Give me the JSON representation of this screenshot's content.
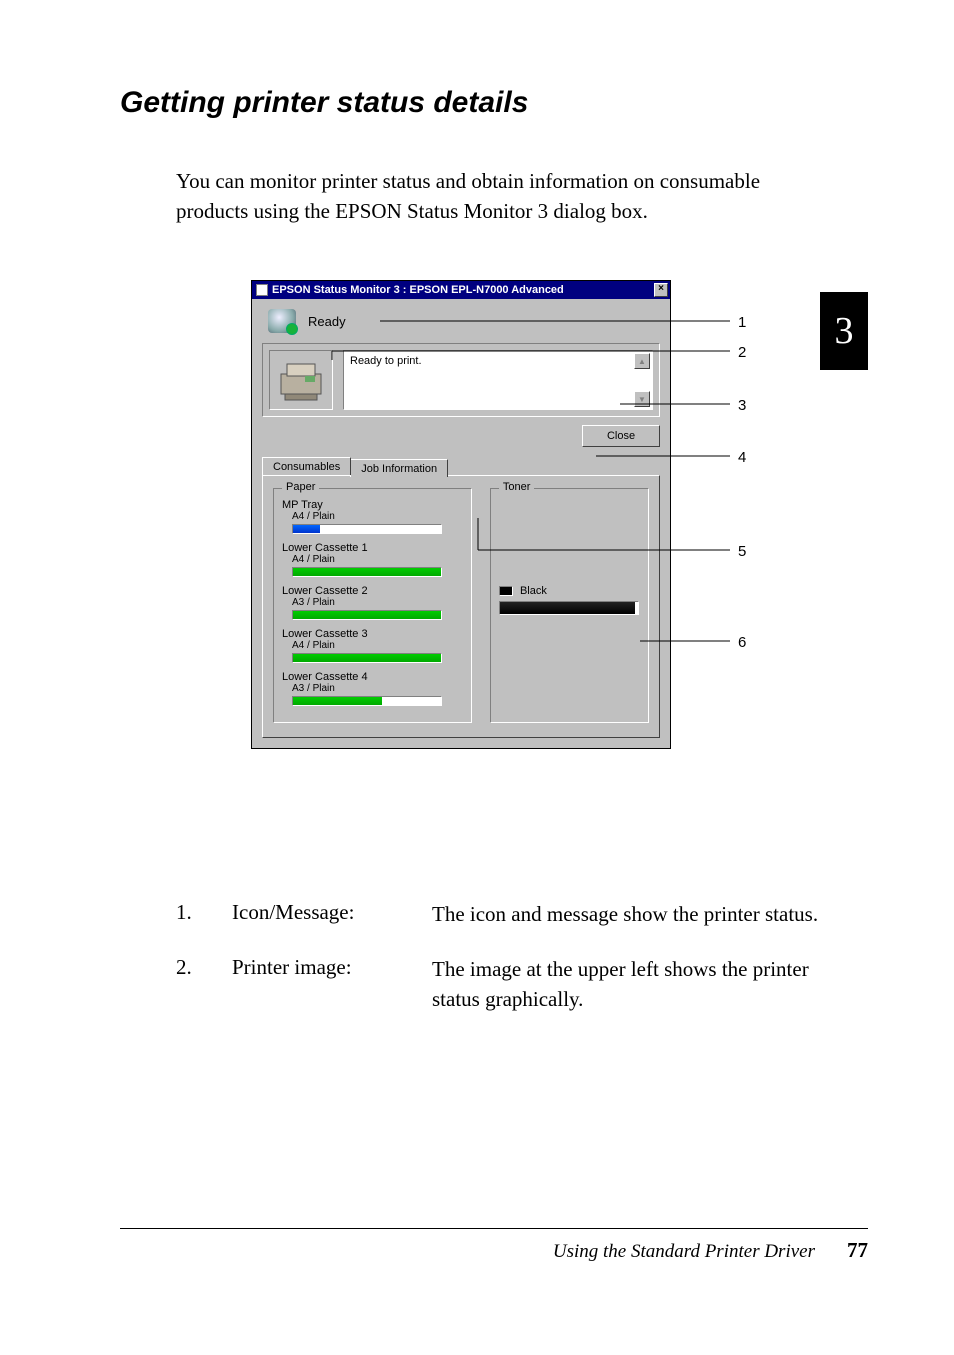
{
  "heading": "Getting printer status details",
  "intro": "You can monitor printer status and obtain information on consumable products using the EPSON Status Monitor 3 dialog box.",
  "chapter_tab": "3",
  "dialog": {
    "title": "EPSON Status Monitor 3 : EPSON EPL-N7000 Advanced",
    "status_text": "Ready",
    "message": "Ready to print.",
    "close_button": "Close",
    "tabs": {
      "consumables": "Consumables",
      "job": "Job Information"
    },
    "paper_group_title": "Paper",
    "toner_group_title": "Toner",
    "paper_items": [
      {
        "label": "MP Tray",
        "sub": "A4 / Plain",
        "fill": 18
      },
      {
        "label": "Lower Cassette 1",
        "sub": "A4 / Plain",
        "fill": 100
      },
      {
        "label": "Lower Cassette 2",
        "sub": "A3 / Plain",
        "fill": 100
      },
      {
        "label": "Lower Cassette 3",
        "sub": "A4 / Plain",
        "fill": 100
      },
      {
        "label": "Lower Cassette 4",
        "sub": "A3 / Plain",
        "fill": 60
      }
    ],
    "toner": {
      "label": "Black",
      "fill": 98
    }
  },
  "callouts": [
    "1",
    "2",
    "3",
    "4",
    "5",
    "6"
  ],
  "defs": [
    {
      "n": "1.",
      "term": "Icon/Message:",
      "desc": "The icon and message show the printer status."
    },
    {
      "n": "2.",
      "term": "Printer image:",
      "desc": "The image at the upper left shows the printer status graphically."
    }
  ],
  "footer": {
    "section": "Using the Standard Printer Driver",
    "page": "77"
  }
}
